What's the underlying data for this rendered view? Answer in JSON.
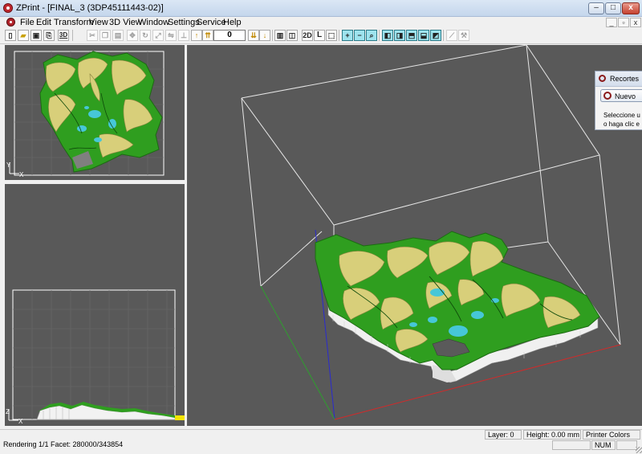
{
  "window": {
    "title": "ZPrint - [FINAL_3 (3DP45111443-02)]",
    "controls": {
      "minimize": "–",
      "maximize": "□",
      "close": "x"
    }
  },
  "menu": {
    "items": [
      "File",
      "Edit",
      "Transform",
      "View",
      "3D View",
      "Window",
      "Settings",
      "Service",
      "Help"
    ],
    "mdi_controls": {
      "minimize": "_",
      "restore": "▫",
      "close": "x"
    }
  },
  "toolbar": {
    "layer_value": "0",
    "label_2d": "2D",
    "label_l": "L",
    "label_3d": "3D"
  },
  "views": {
    "top_axis": {
      "y": "Y",
      "x": "X"
    },
    "front_axis": {
      "z": "Z",
      "x": "X"
    }
  },
  "popup": {
    "header": "Recortes",
    "new_button": "Nuevo",
    "hint_line1": "Seleccione u",
    "hint_line2": "o haga clic e"
  },
  "status": {
    "rendering": "Rendering 1/1 Facet: 280000/343854",
    "layer": "Layer: 0",
    "height": "Height: 0.00 mm",
    "printer_colors": "Printer Colors",
    "num": "NUM"
  },
  "colors": {
    "viewport_bg": "#595959",
    "terrain_green": "#2f9e1f",
    "terrain_yellow": "#d8cf7a",
    "water": "#46c7d8",
    "axis_red": "#d22a2a",
    "axis_green": "#2e9e2e",
    "axis_blue": "#2a2ad0"
  }
}
